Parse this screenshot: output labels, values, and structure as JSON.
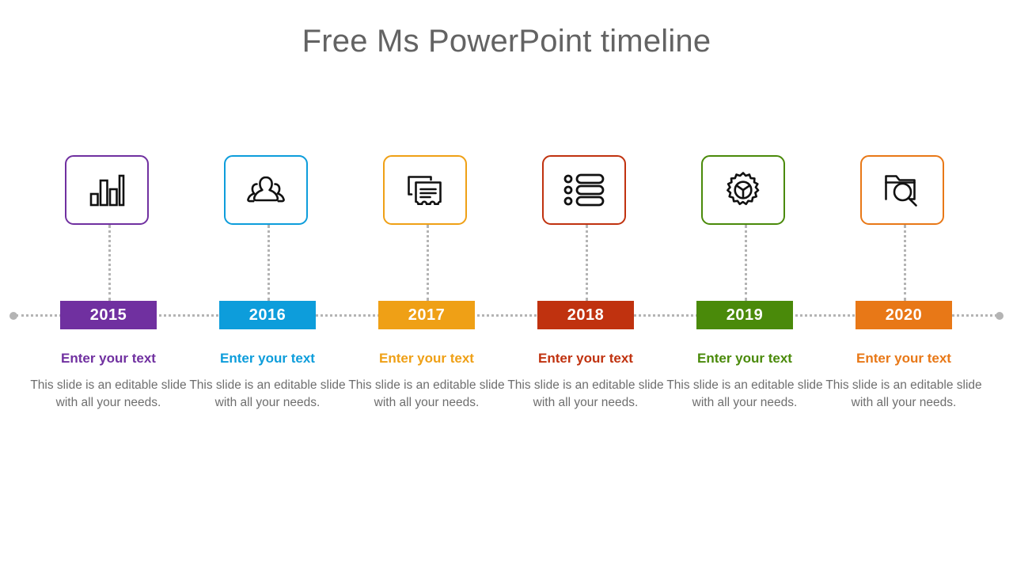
{
  "slide": {
    "title": "Free Ms PowerPoint timeline",
    "title_color": "#636363",
    "background": "#ffffff",
    "axis_color": "#b4b4b4",
    "body_text_color": "#6e6e6e"
  },
  "timeline": {
    "left_cap_icon": "circle-cap-icon",
    "right_cap_icon": "circle-cap-icon",
    "milestones": [
      {
        "year": "2015",
        "color": "#7030A0",
        "icon": "bar-chart-icon",
        "heading": "Enter your text",
        "body": "This slide is an editable slide with all your needs."
      },
      {
        "year": "2016",
        "color": "#0D9DDB",
        "icon": "users-group-icon",
        "heading": "Enter your text",
        "body": "This slide is an editable slide with all your needs."
      },
      {
        "year": "2017",
        "color": "#EFA016",
        "icon": "documents-certificate-icon",
        "heading": "Enter your text",
        "body": "This slide is an editable slide with all your needs."
      },
      {
        "year": "2018",
        "color": "#C0320F",
        "icon": "bulleted-list-icon",
        "heading": "Enter your text",
        "body": "This slide is an editable slide with all your needs."
      },
      {
        "year": "2019",
        "color": "#4A8A0A",
        "icon": "gear-steering-icon",
        "heading": "Enter your text",
        "body": "This slide is an editable slide with all your needs."
      },
      {
        "year": "2020",
        "color": "#E87817",
        "icon": "folder-search-icon",
        "heading": "Enter your text",
        "body": "This slide is an editable slide with all your needs."
      }
    ]
  }
}
